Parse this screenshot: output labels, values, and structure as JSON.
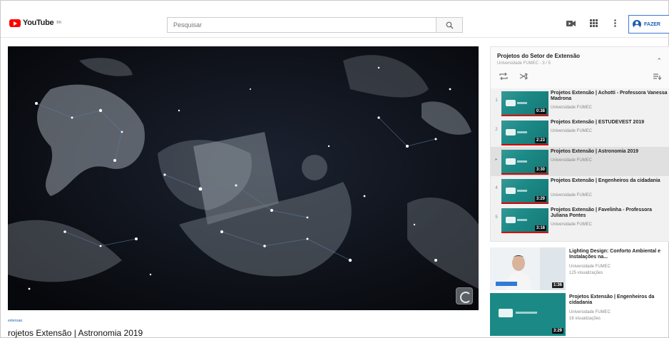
{
  "header": {
    "logo_text": "YouTube",
    "logo_sup": "BR",
    "search_placeholder": "Pesquisar",
    "signin_label": "FAZER"
  },
  "player": {
    "tag": "extensao",
    "title": "rojetos Extensão | Astronomia 2019"
  },
  "playlist": {
    "title": "Projetos do Setor de Extensão",
    "subtitle": "Universidade FUMEC - 3 / 5",
    "items": [
      {
        "index": "1",
        "title": "Projetos Extensão | Achotti - Professora Vanessa Madrona",
        "channel": "Universidade FUMEC",
        "duration": "0:38",
        "active": false
      },
      {
        "index": "2",
        "title": "Projetos Extensão | ESTUDEVEST 2019",
        "channel": "Universidade FUMEC",
        "duration": "2:23",
        "active": false
      },
      {
        "index": "▸",
        "title": "Projetos Extensão | Astronomia 2019",
        "channel": "Universidade FUMEC",
        "duration": "3:30",
        "active": true
      },
      {
        "index": "4",
        "title": "Projetos Extensão | Engenheiros da cidadania",
        "channel": "Universidade FUMEC",
        "duration": "3:29",
        "active": false
      },
      {
        "index": "5",
        "title": "Projetos Extensão | Favelinha - Professora Juliana Pontes",
        "channel": "Universidade FUMEC",
        "duration": "3:18",
        "active": false
      }
    ]
  },
  "recommendations": [
    {
      "title": "Lighting Design: Conforto Ambiental e Instalações na...",
      "channel": "Universidade FUMEC",
      "views": "125 visualizações",
      "duration": "1:36"
    },
    {
      "title": "Projetos Extensão | Engenheiros da cidadania",
      "channel": "Universidade FUMEC",
      "views": "16 visualizações",
      "duration": "3:29"
    }
  ],
  "colors": {
    "accent_red": "#ff0000",
    "signin_blue": "#1a5fb4",
    "thumb_teal": "#1b8a87"
  }
}
